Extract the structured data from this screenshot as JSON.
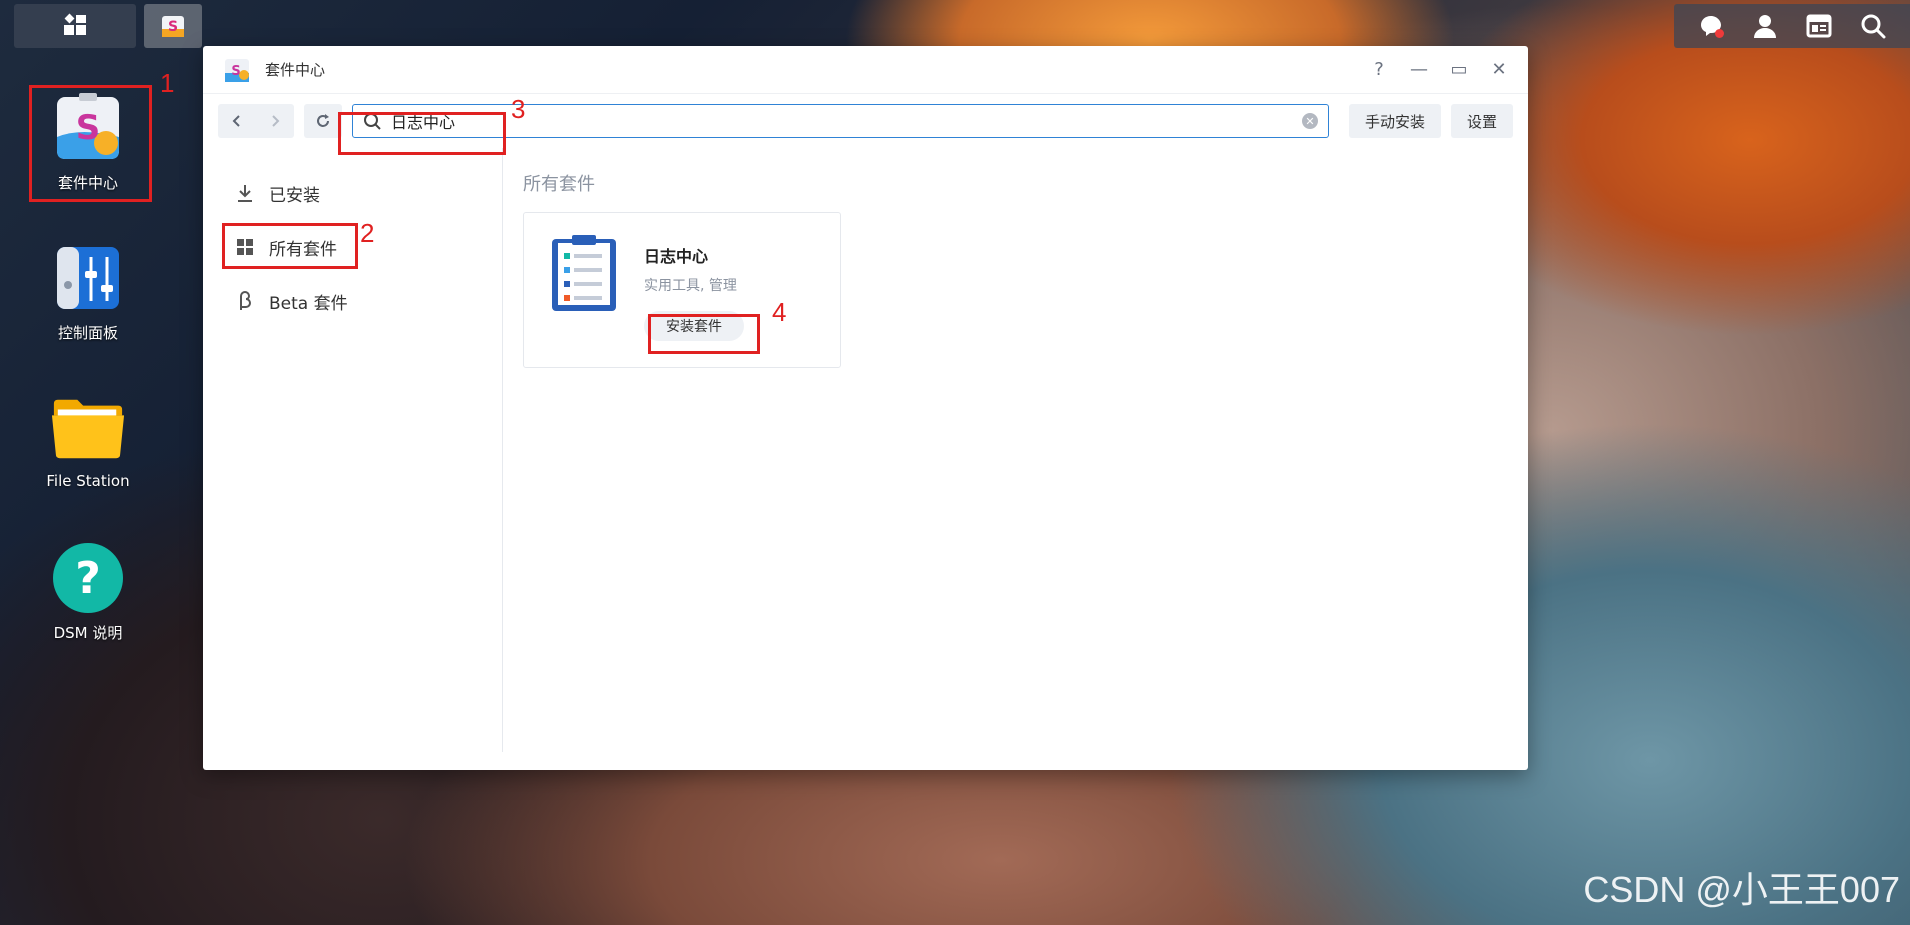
{
  "desktop": {
    "icons": [
      {
        "label": "套件中心"
      },
      {
        "label": "控制面板"
      },
      {
        "label": "File Station"
      },
      {
        "label": "DSM 说明"
      }
    ]
  },
  "window": {
    "title": "套件中心",
    "controls": {
      "help": "?",
      "minimize": "—",
      "maximize": "▭",
      "close": "✕"
    },
    "search": {
      "value": "日志中心"
    },
    "toolbar": {
      "manual_install": "手动安装",
      "settings": "设置"
    },
    "sidebar": {
      "items": [
        {
          "label": "已安装"
        },
        {
          "label": "所有套件"
        },
        {
          "label": "Beta 套件"
        }
      ]
    },
    "main": {
      "section_title": "所有套件",
      "package": {
        "name": "日志中心",
        "category": "实用工具, 管理",
        "install_label": "安装套件"
      }
    }
  },
  "annotations": [
    "1",
    "2",
    "3",
    "4"
  ],
  "watermark": "CSDN @小王王007"
}
